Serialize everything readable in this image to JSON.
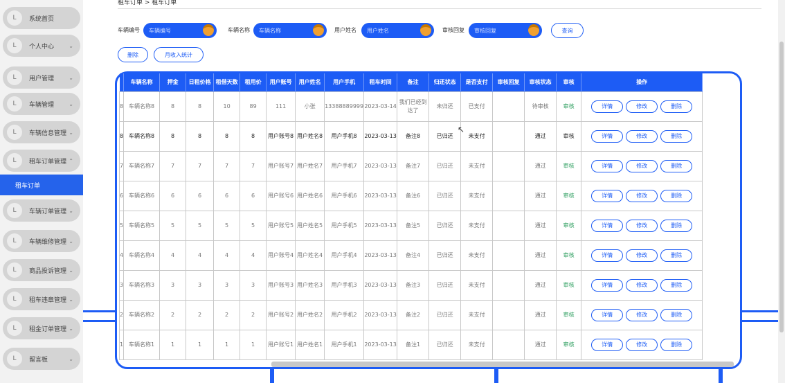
{
  "sidebar": {
    "items": [
      {
        "label": "系统首页",
        "chevron": ""
      },
      {
        "label": "个人中心",
        "chevron": "⌄"
      },
      {
        "label": "用户管理",
        "chevron": "⌄"
      },
      {
        "label": "车辆管理",
        "chevron": "⌄"
      },
      {
        "label": "车辆信息管理",
        "chevron": "⌄"
      },
      {
        "label": "租车订单管理",
        "chevron": "⌃"
      },
      {
        "label": "车辆订单管理",
        "chevron": "⌄"
      },
      {
        "label": "车辆维修管理",
        "chevron": "⌄"
      },
      {
        "label": "商品投诉管理",
        "chevron": "⌄"
      },
      {
        "label": "租车违章管理",
        "chevron": "⌄"
      },
      {
        "label": "租金订单管理",
        "chevron": "⌄"
      },
      {
        "label": "留言板",
        "chevron": "⌄"
      }
    ],
    "active_subitem": "租车订单",
    "item_icon": "L"
  },
  "breadcrumb": "租车订单 > 租车订单",
  "filters": {
    "car_no_label": "车辆编号",
    "car_no_placeholder": "车辆编号",
    "car_name_label": "车辆名称",
    "car_name_placeholder": "车辆名称",
    "user_name_label": "用户姓名",
    "user_name_placeholder": "用户姓名",
    "review_label": "审核回复",
    "review_placeholder": "审核回复",
    "search_button": "查询"
  },
  "actions": {
    "delete_button": "删除",
    "stats_button": "月收入统计"
  },
  "table": {
    "headers": [
      "车辆名称",
      "押金",
      "日租价格",
      "租借天数",
      "租用价",
      "用户账号",
      "用户姓名",
      "用户手机",
      "租车时间",
      "备注",
      "归还状态",
      "是否支付",
      "审核回复",
      "审核状态",
      "审核",
      "操作"
    ],
    "row_buttons": [
      "详情",
      "修改",
      "删除"
    ],
    "rows": [
      {
        "idx": "8",
        "name": "车辆名称8",
        "deposit": "8",
        "daily": "8",
        "days": "10",
        "price": "89",
        "account": "111",
        "uname": "小张",
        "phone": "13388889999",
        "time": "2023-03-14",
        "note": "我们已经到达了",
        "ret": "未归还",
        "paid": "已支付",
        "reply": "",
        "rstatus": "待审核",
        "audit": "审核",
        "dark": false
      },
      {
        "idx": "8",
        "name": "车辆名称8",
        "deposit": "8",
        "daily": "8",
        "days": "8",
        "price": "8",
        "account": "用户账号8",
        "uname": "用户姓名8",
        "phone": "用户手机8",
        "time": "2023-03-13",
        "note": "备注8",
        "ret": "已归还",
        "paid": "未支付",
        "reply": "",
        "rstatus": "通过",
        "audit": "审核",
        "dark": true
      },
      {
        "idx": "7",
        "name": "车辆名称7",
        "deposit": "7",
        "daily": "7",
        "days": "7",
        "price": "7",
        "account": "用户账号7",
        "uname": "用户姓名7",
        "phone": "用户手机7",
        "time": "2023-03-13",
        "note": "备注7",
        "ret": "已归还",
        "paid": "未支付",
        "reply": "",
        "rstatus": "通过",
        "audit": "审核",
        "dark": false
      },
      {
        "idx": "6",
        "name": "车辆名称6",
        "deposit": "6",
        "daily": "6",
        "days": "6",
        "price": "6",
        "account": "用户账号6",
        "uname": "用户姓名6",
        "phone": "用户手机6",
        "time": "2023-03-13",
        "note": "备注6",
        "ret": "已归还",
        "paid": "未支付",
        "reply": "",
        "rstatus": "通过",
        "audit": "审核",
        "dark": false
      },
      {
        "idx": "5",
        "name": "车辆名称5",
        "deposit": "5",
        "daily": "5",
        "days": "5",
        "price": "5",
        "account": "用户账号5",
        "uname": "用户姓名5",
        "phone": "用户手机5",
        "time": "2023-03-13",
        "note": "备注5",
        "ret": "已归还",
        "paid": "未支付",
        "reply": "",
        "rstatus": "通过",
        "audit": "审核",
        "dark": false
      },
      {
        "idx": "4",
        "name": "车辆名称4",
        "deposit": "4",
        "daily": "4",
        "days": "4",
        "price": "4",
        "account": "用户账号4",
        "uname": "用户姓名4",
        "phone": "用户手机4",
        "time": "2023-03-13",
        "note": "备注4",
        "ret": "已归还",
        "paid": "未支付",
        "reply": "",
        "rstatus": "通过",
        "audit": "审核",
        "dark": false
      },
      {
        "idx": "3",
        "name": "车辆名称3",
        "deposit": "3",
        "daily": "3",
        "days": "3",
        "price": "3",
        "account": "用户账号3",
        "uname": "用户姓名3",
        "phone": "用户手机3",
        "time": "2023-03-13",
        "note": "备注3",
        "ret": "已归还",
        "paid": "未支付",
        "reply": "",
        "rstatus": "通过",
        "audit": "审核",
        "dark": false
      },
      {
        "idx": "2",
        "name": "车辆名称2",
        "deposit": "2",
        "daily": "2",
        "days": "2",
        "price": "2",
        "account": "用户账号2",
        "uname": "用户姓名2",
        "phone": "用户手机2",
        "time": "2023-03-13",
        "note": "备注2",
        "ret": "已归还",
        "paid": "未支付",
        "reply": "",
        "rstatus": "通过",
        "audit": "审核",
        "dark": false
      },
      {
        "idx": "1",
        "name": "车辆名称1",
        "deposit": "1",
        "daily": "1",
        "days": "1",
        "price": "1",
        "account": "用户账号1",
        "uname": "用户姓名1",
        "phone": "用户手机1",
        "time": "2023-03-13",
        "note": "备注1",
        "ret": "已归还",
        "paid": "未支付",
        "reply": "",
        "rstatus": "通过",
        "audit": "审核",
        "dark": false
      }
    ]
  },
  "colors": {
    "primary": "#1d5cf5",
    "knob": "#f0a030",
    "status_green": "#2a9d5c"
  }
}
